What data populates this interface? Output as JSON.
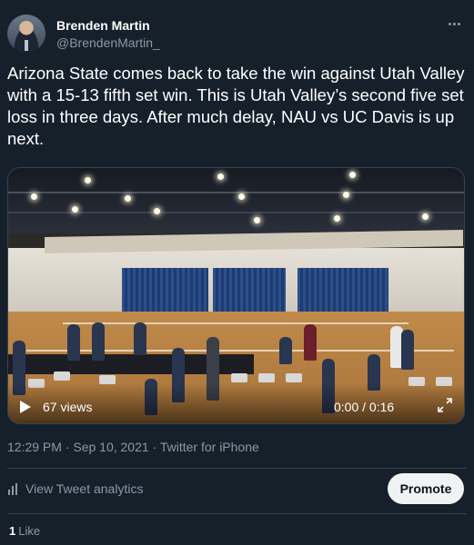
{
  "author": {
    "display_name": "Brenden Martin",
    "handle": "@BrendenMartin_"
  },
  "tweet": {
    "text": "Arizona State comes back to take the win against Utah Valley with a 15-13 fifth set win. This is Utah Valley’s second five set loss in three days. After much delay, NAU vs UC Davis is up next."
  },
  "video": {
    "views": "67 views",
    "timecode": "0:00 / 0:16",
    "progress": 0
  },
  "meta": {
    "timestamp": "12:29 PM · Sep 10, 2021 · Twitter for iPhone"
  },
  "actions": {
    "analytics_label": "View Tweet analytics",
    "promote_label": "Promote"
  },
  "engagement": {
    "like_count": "1",
    "like_label": "Like"
  },
  "colors": {
    "background": "#15202b",
    "secondary_text": "#8b98a5",
    "divider": "#38444d",
    "promote_bg": "#eff3f4"
  },
  "icons": [
    "more-icon",
    "play-icon",
    "fullscreen-icon",
    "analytics-icon"
  ]
}
